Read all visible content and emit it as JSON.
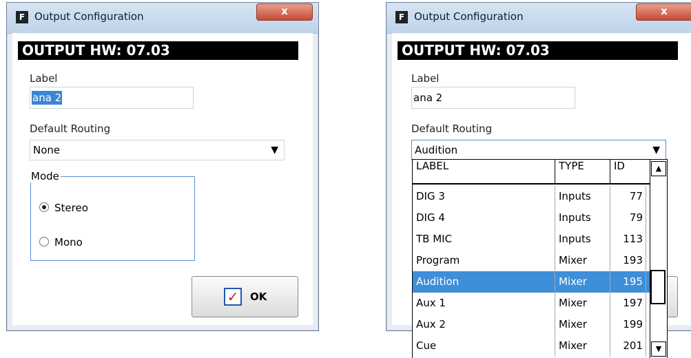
{
  "left_dialog": {
    "app_icon": "F",
    "title": "Output Configuration",
    "close_glyph": "x",
    "hw_header": "OUTPUT HW: 07.03",
    "label_caption": "Label",
    "label_value": "ana 2",
    "routing_caption": "Default Routing",
    "routing_value": "None",
    "mode_group": "Mode",
    "mode_options": [
      "Stereo",
      "Mono"
    ],
    "mode_selected": "Stereo",
    "ok_label": "OK"
  },
  "right_dialog": {
    "app_icon": "F",
    "title": "Output Configuration",
    "close_glyph": "x",
    "hw_header": "OUTPUT HW: 07.03",
    "label_caption": "Label",
    "label_value": "ana 2",
    "routing_caption": "Default Routing",
    "routing_value": "Audition",
    "dropdown": {
      "columns": [
        "LABEL",
        "TYPE",
        "ID"
      ],
      "rows": [
        {
          "label": "DIG 3",
          "type": "Inputs",
          "id": "77"
        },
        {
          "label": "DIG 4",
          "type": "Inputs",
          "id": "79"
        },
        {
          "label": "TB MIC",
          "type": "Inputs",
          "id": "113"
        },
        {
          "label": "Program",
          "type": "Mixer",
          "id": "193"
        },
        {
          "label": "Audition",
          "type": "Mixer",
          "id": "195"
        },
        {
          "label": "Aux 1",
          "type": "Mixer",
          "id": "197"
        },
        {
          "label": "Aux 2",
          "type": "Mixer",
          "id": "199"
        },
        {
          "label": "Cue",
          "type": "Mixer",
          "id": "201"
        }
      ],
      "selected_row": "Audition"
    }
  },
  "colors": {
    "selection": "#3e8ed8",
    "titlebar": "#c7d9ee",
    "close_button": "#c74a33",
    "header_bar": "#000000"
  }
}
